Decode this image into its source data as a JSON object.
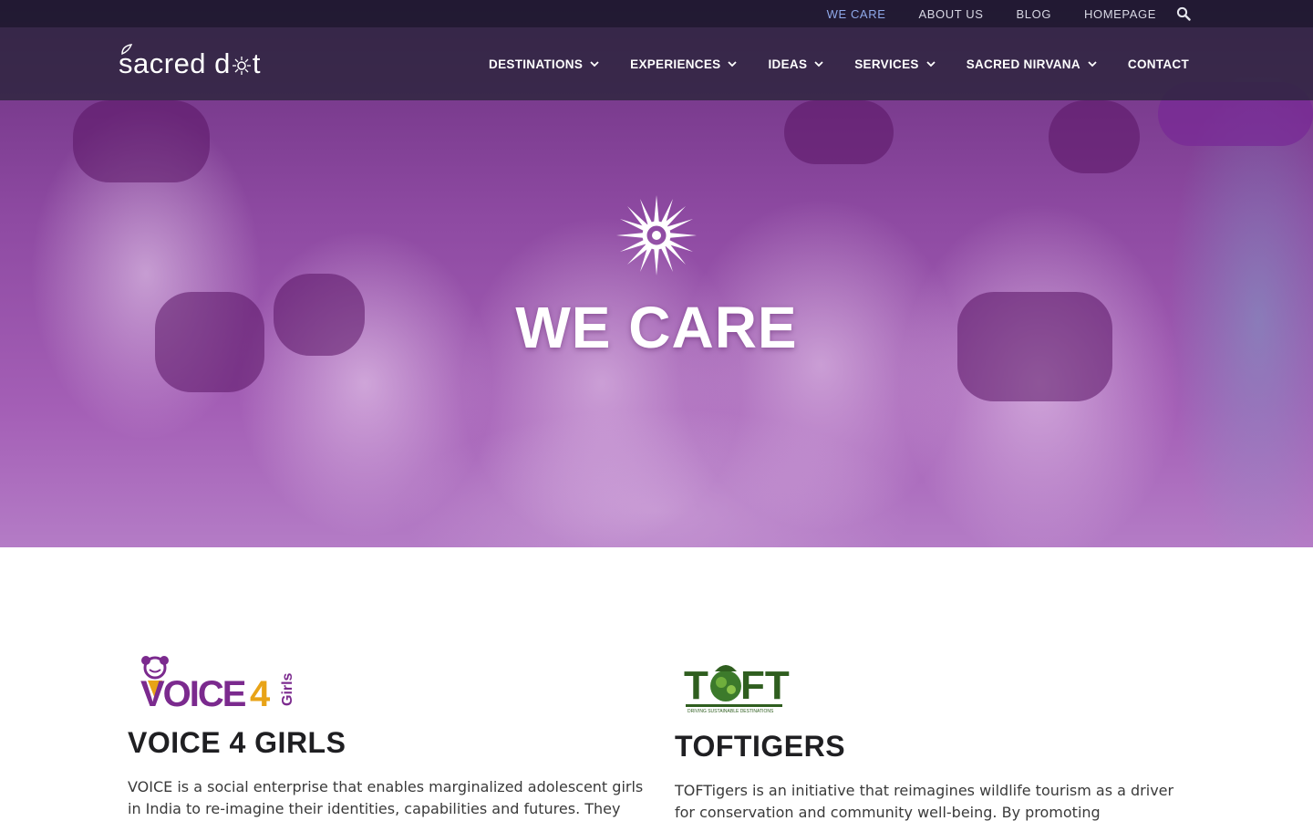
{
  "topbar": {
    "links": [
      {
        "label": "WE CARE",
        "active": true
      },
      {
        "label": "ABOUT US",
        "active": false
      },
      {
        "label": "BLOG",
        "active": false
      },
      {
        "label": "HOMEPAGE",
        "active": false
      }
    ],
    "search_icon": "search-icon"
  },
  "brand": {
    "logo_text_a": "sacred d",
    "logo_text_b": "t"
  },
  "nav": {
    "items": [
      {
        "label": "DESTINATIONS",
        "has_dropdown": true
      },
      {
        "label": "EXPERIENCES",
        "has_dropdown": true
      },
      {
        "label": "IDEAS",
        "has_dropdown": true
      },
      {
        "label": "SERVICES",
        "has_dropdown": true
      },
      {
        "label": "SACRED NIRVANA",
        "has_dropdown": true
      },
      {
        "label": "CONTACT",
        "has_dropdown": false
      }
    ]
  },
  "hero": {
    "title": "WE CARE",
    "emblem_icon": "sun-emblem-icon"
  },
  "cards": [
    {
      "logo_text": "VOICE4",
      "logo_subtext": "Girls",
      "title": "VOICE 4 GIRLS",
      "body": "VOICE is a social enterprise that enables marginalized adolescent girls in India to re-imagine their identities, capabilities and futures. They"
    },
    {
      "logo_text": "TOFT",
      "logo_subtext": "DRIVING SUSTAINABLE DESTINATIONS",
      "title": "TOFTIGERS",
      "body": "TOFTigers is an initiative that reimagines wildlife tourism as a driver for conservation and community well-being. By promoting"
    }
  ],
  "colors": {
    "brand_purple": "#7b2a8e",
    "accent_blue": "#8fa8e8",
    "voice_gold": "#e8a317",
    "toft_green": "#2f5e1f"
  }
}
